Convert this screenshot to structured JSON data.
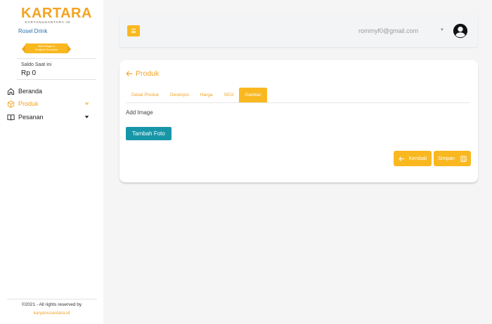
{
  "sidebar": {
    "logo_main": "KARTARA",
    "logo_sub": "KARYANUSANTARA.ID",
    "store_name": "Rosel Drink",
    "badge_line1": "Mitra Pangan &",
    "badge_line2": "Kerajinan Nusantara",
    "saldo_label": "Saldo Saat ini",
    "saldo_value": "Rp 0",
    "nav": {
      "beranda": "Beranda",
      "produk": "Produk",
      "pesanan": "Pesanan"
    },
    "footer_copy": "©2021 - All rights reserved by",
    "footer_link": "karyanusantara.id"
  },
  "topbar": {
    "email": "rommyf0@gmail.com",
    "email_caret": "▼"
  },
  "card": {
    "title": "Produk",
    "tabs": [
      "Detail Produk",
      "Deskripsi",
      "Harga",
      "SEO",
      "Gambar"
    ],
    "active_tab": "Gambar",
    "add_image_label": "Add Image",
    "tambah_label": "Tambah Foto",
    "kembali_label": "Kembali",
    "simpan_label": "Simpan"
  },
  "colors": {
    "accent": "#f9b820",
    "accent_text": "#f4a322",
    "teal": "#1796a8",
    "link_blue": "#2a6fb0"
  },
  "icons": {
    "home": "home-icon",
    "product": "box-icon",
    "orders": "book-open-icon",
    "hamburger": "hamburger-icon",
    "avatar": "user-circle-icon",
    "back": "arrow-left-icon",
    "save": "floppy-disk-icon"
  }
}
